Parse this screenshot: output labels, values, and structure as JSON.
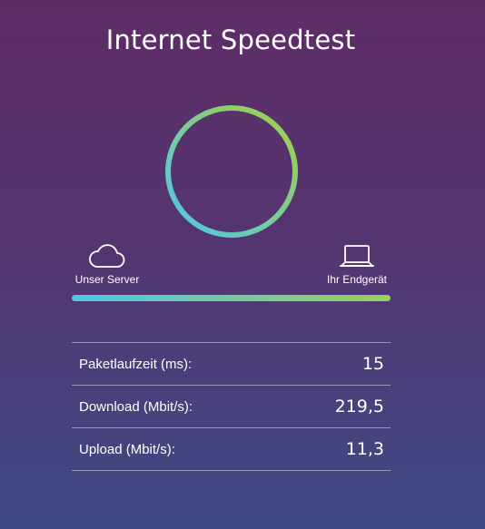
{
  "header": {
    "title": "Internet Speedtest"
  },
  "gauge": {
    "icon": "progress-ring",
    "progress": 1.0,
    "colors": {
      "start": "#4fc7e8",
      "end": "#a4d143"
    }
  },
  "endpoints": {
    "server": {
      "label": "Unser Server",
      "icon": "cloud-icon"
    },
    "device": {
      "label": "Ihr Endgerät",
      "icon": "laptop-icon"
    }
  },
  "transfer_bar": {
    "progress": 1.0,
    "colors": {
      "start": "#4fc7e8",
      "end": "#9ad05a"
    }
  },
  "results": [
    {
      "label": "Paketlaufzeit (ms):",
      "value": "15"
    },
    {
      "label": "Download (Mbit/s):",
      "value": "219,5"
    },
    {
      "label": "Upload (Mbit/s):",
      "value": "11,3"
    }
  ]
}
